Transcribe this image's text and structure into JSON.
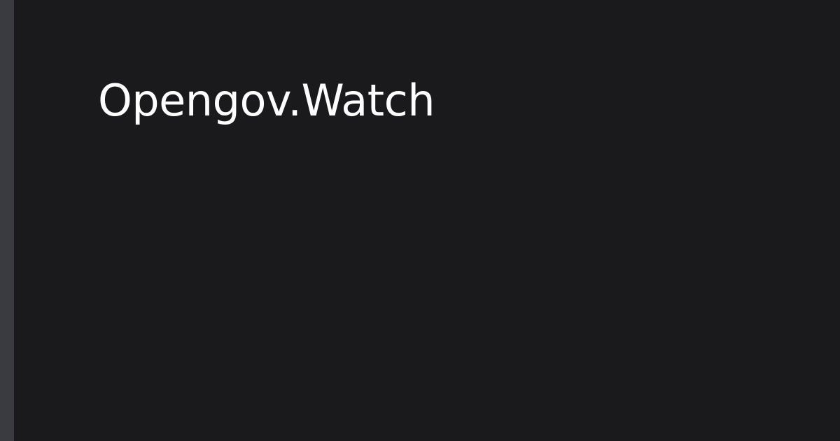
{
  "site": {
    "title": "Opengov.Watch"
  },
  "colors": {
    "background": "#1a1a1c",
    "accent_bar": "#3a3b40",
    "title_text": "#ffffff"
  }
}
